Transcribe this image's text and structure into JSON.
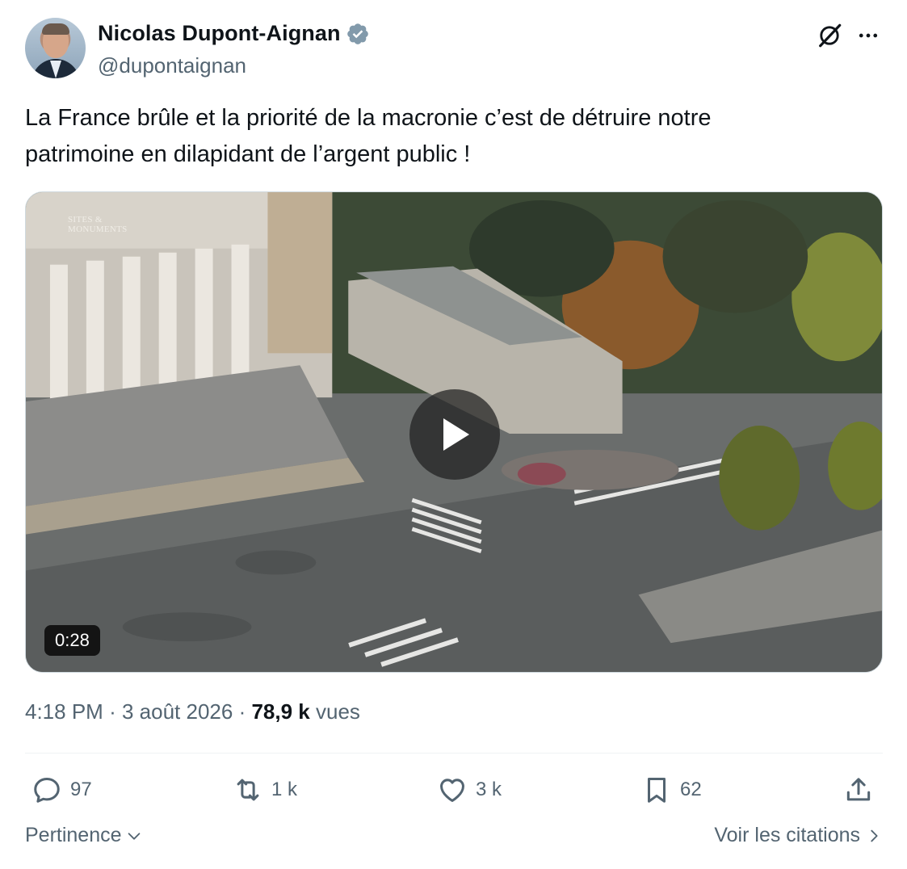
{
  "author": {
    "display_name": "Nicolas Dupont-Aignan",
    "handle": "@dupontaignan",
    "verified": true,
    "verified_color": "#829aab"
  },
  "header_actions": {
    "grok_icon": "grok-slash-circle-icon",
    "more_icon": "more-dots-icon"
  },
  "tweet": {
    "text_line1": "La France brûle et la priorité de la macronie c’est de détruire notre",
    "text_line2": "patrimoine en dilapidant de l’argent public !"
  },
  "media": {
    "type": "video",
    "duration": "0:28",
    "watermark_line1": "SITES &",
    "watermark_line2": "MONUMENTS",
    "play_icon": "play-icon"
  },
  "meta": {
    "time": "4:18 PM",
    "separator": "·",
    "date": "3 août 2026",
    "views_count": "78,9 k",
    "views_label": "vues"
  },
  "actions": {
    "replies": "97",
    "reposts": "1 k",
    "likes": "3 k",
    "bookmarks": "62"
  },
  "footer": {
    "sort_label": "Pertinence",
    "quotes_label": "Voir les citations"
  },
  "colors": {
    "text_primary": "#0f1419",
    "text_secondary": "#536471",
    "divider": "#eff3f4"
  }
}
